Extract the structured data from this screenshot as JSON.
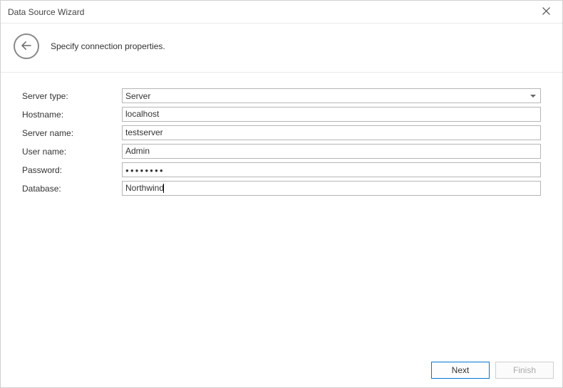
{
  "window": {
    "title": "Data Source Wizard"
  },
  "header": {
    "subtitle": "Specify connection properties."
  },
  "form": {
    "labels": {
      "server_type": "Server type:",
      "hostname": "Hostname:",
      "server_name": "Server name:",
      "user_name": "User name:",
      "password": "Password:",
      "database": "Database:"
    },
    "values": {
      "server_type": "Server",
      "hostname": "localhost",
      "server_name": "testserver",
      "user_name": "Admin",
      "password": "●●●●●●●●",
      "database": "Northwind"
    }
  },
  "footer": {
    "next": "Next",
    "finish": "Finish"
  }
}
